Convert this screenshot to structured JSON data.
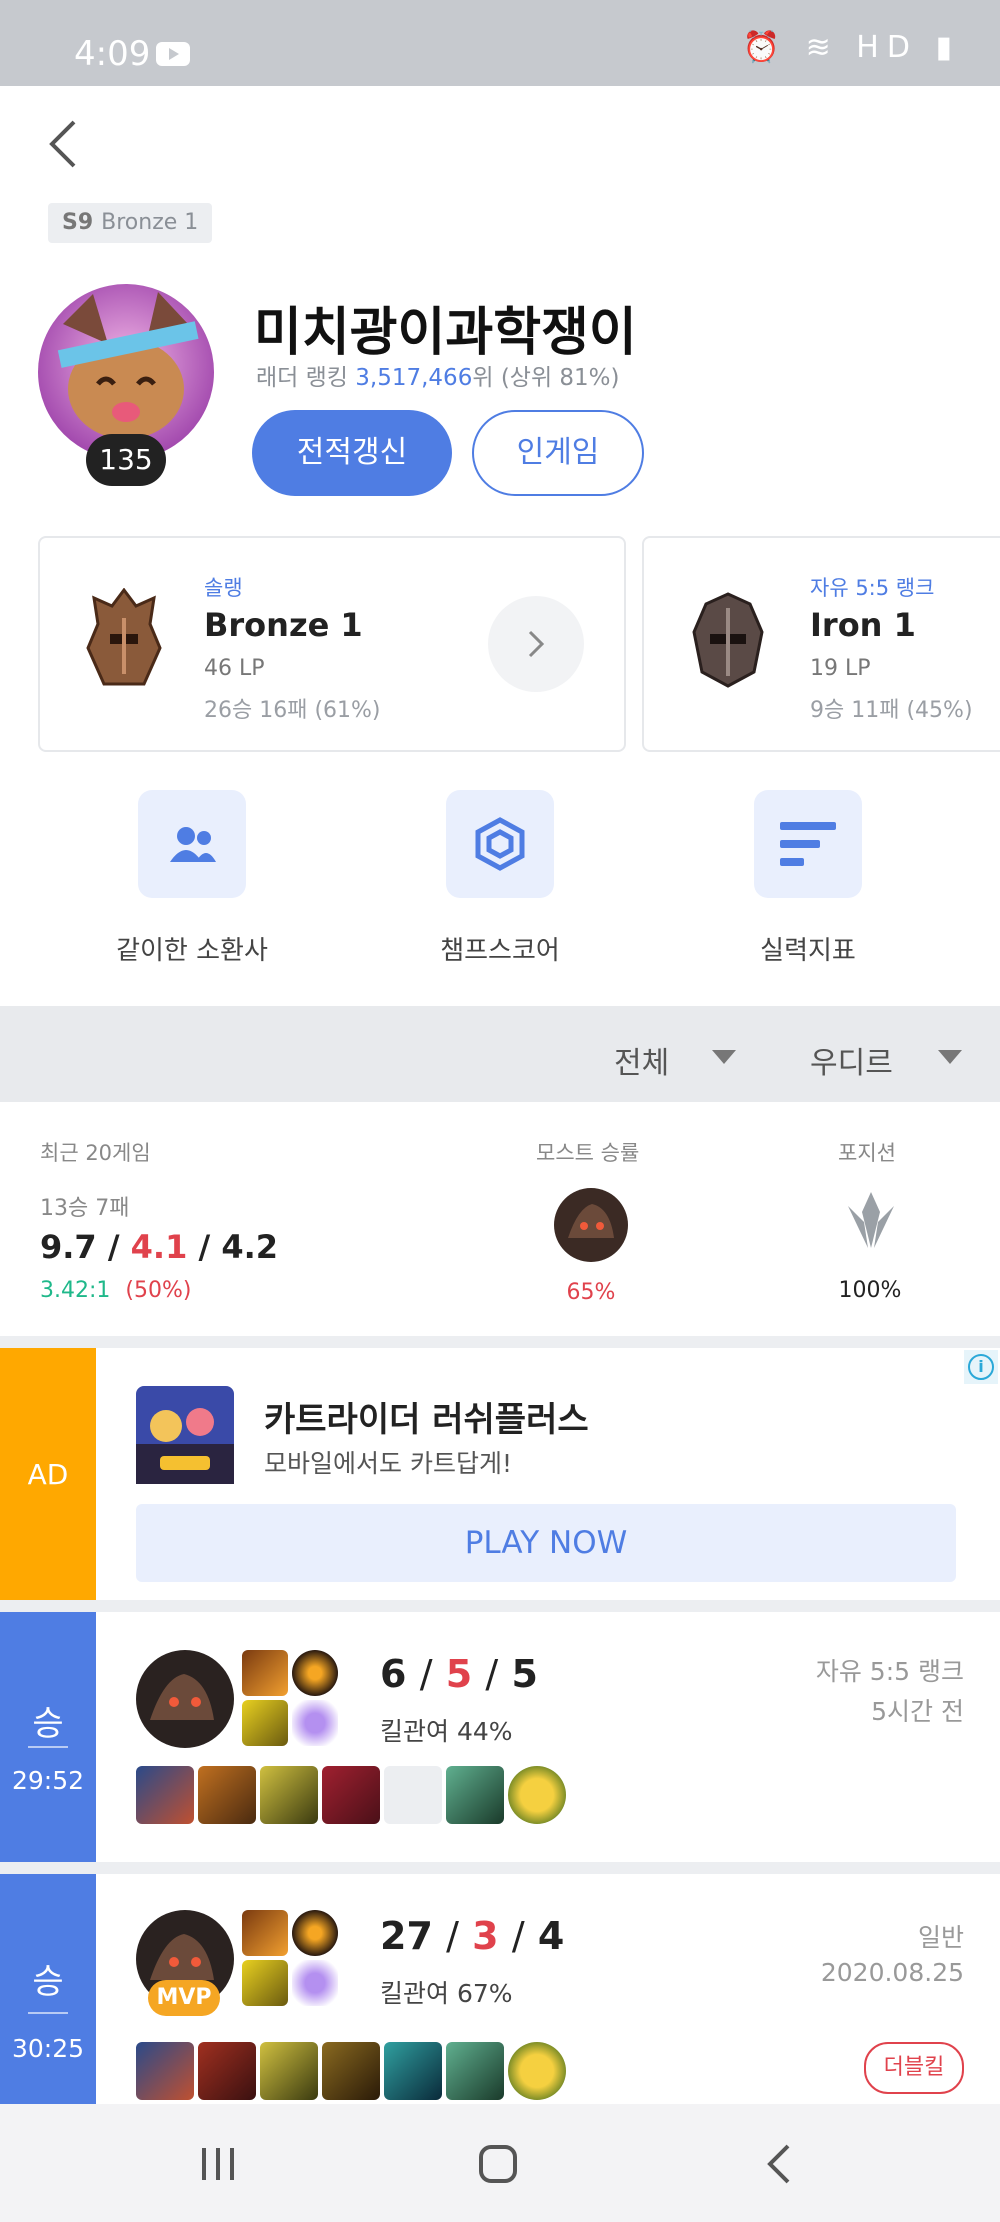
{
  "status_bar": {
    "time": "4:09",
    "icons": "⏰ ≋ HD ▮"
  },
  "header": {
    "back_icon": "back-arrow-icon",
    "season": "S9",
    "season_tier": "Bronze 1",
    "level": "135",
    "summoner_name": "미치광이과학쟁이",
    "ladder_prefix": "래더 랭킹",
    "ladder_rank": "3,517,466",
    "ladder_suffix": "위",
    "ladder_top": "(상위 81%)",
    "refresh_button": "전적갱신",
    "ingame_button": "인게임"
  },
  "rank_cards": [
    {
      "queue": "솔랭",
      "tier": "Bronze 1",
      "lp": "46 LP",
      "record": "26승 16패 (61%)"
    },
    {
      "queue": "자유 5:5 랭크",
      "tier": "Iron 1",
      "lp": "19 LP",
      "record": "9승 11패 (45%)"
    }
  ],
  "shortcuts": [
    {
      "label": "같이한 소환사",
      "icon": "people-icon"
    },
    {
      "label": "챔프스코어",
      "icon": "hexagon-icon"
    },
    {
      "label": "실력지표",
      "icon": "bars-icon"
    }
  ],
  "filters": {
    "mode": "전체",
    "champion": "우디르"
  },
  "summary": {
    "recent_label": "최근 20게임",
    "record": "13승 7패",
    "kills": "9.7",
    "deaths": "4.1",
    "assists": "4.2",
    "slash": "/",
    "kda_ratio": "3.42:1",
    "kda_pct": "(50%)",
    "most_label": "모스트 승률",
    "most_winrate": "65%",
    "position_label": "포지션",
    "position_pct": "100%"
  },
  "ad": {
    "side_label": "AD",
    "title": "카트라이더 러쉬플러스",
    "subtitle": "모바일에서도 카트답게!",
    "cta": "PLAY NOW",
    "info_icon": "info-icon"
  },
  "matches": [
    {
      "result": "승",
      "duration": "29:52",
      "kills": "6",
      "deaths": "5",
      "assists": "5",
      "kill_participation": "킬관여 44%",
      "queue": "자유 5:5 랭크",
      "time": "5시간 전"
    },
    {
      "result": "승",
      "duration": "30:25",
      "kills": "27",
      "deaths": "3",
      "assists": "4",
      "kill_participation": "킬관여 67%",
      "queue": "일반",
      "time": "2020.08.25",
      "badge": "MVP",
      "tag": "더블킬"
    }
  ],
  "colors": {
    "accent": "#4f7de3",
    "death_red": "#e0424c",
    "kda_green": "#1fb88a",
    "ad_orange": "#ffa800"
  },
  "nav_bar": {
    "recent_icon": "recent-apps-icon",
    "home_icon": "home-icon",
    "back_icon": "nav-back-icon"
  }
}
